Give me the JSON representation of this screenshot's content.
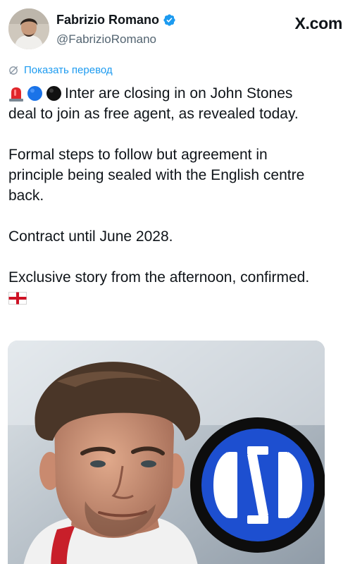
{
  "author": {
    "name": "Fabrizio Romano",
    "handle": "@FabrizioRomano",
    "verified": true
  },
  "brand": "X.com",
  "translate": {
    "label": "Показать перевод",
    "icon": "translate-icon"
  },
  "tweet": {
    "line1": "Inter are closing in on John Stones",
    "line2": "deal to join as free agent, as revealed today.",
    "line3": "Formal steps to follow but agreement in",
    "line4": "principle being sealed with the English centre",
    "line5": "back.",
    "line6": "Contract until June 2028.",
    "line7": "Exclusive story from the afternoon, confirmed.",
    "emojis": [
      "siren-emoji",
      "blue-circle-emoji",
      "black-circle-emoji",
      "england-flag-emoji"
    ]
  },
  "colors": {
    "link": "#1d9bf0",
    "verified": "#1d9bf0",
    "text": "#0f1419",
    "secondary": "#536471",
    "inter_blue": "#1d4fd0"
  }
}
